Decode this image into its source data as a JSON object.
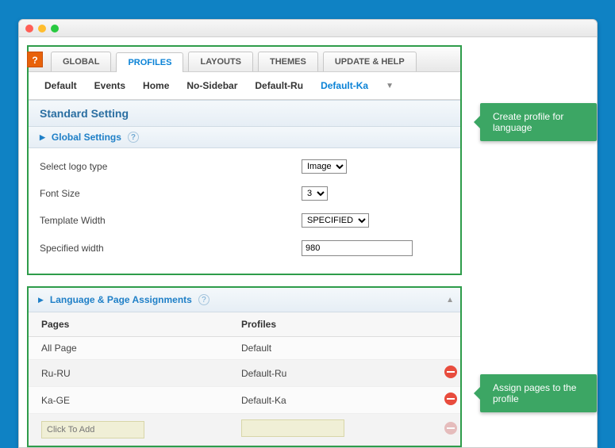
{
  "tabs": {
    "global": "GLOBAL",
    "profiles": "PROFILES",
    "layouts": "LAYOUTS",
    "themes": "THEMES",
    "update": "UPDATE & HELP"
  },
  "profileTabs": {
    "default": "Default",
    "events": "Events",
    "home": "Home",
    "nosidebar": "No-Sidebar",
    "defaultru": "Default-Ru",
    "defaultka": "Default-Ka"
  },
  "section": {
    "standard": "Standard Setting",
    "globalSettings": "Global Settings"
  },
  "form": {
    "logoLabel": "Select logo type",
    "logoValue": "Image",
    "fontLabel": "Font Size",
    "fontValue": "3",
    "widthLabel": "Template Width",
    "widthValue": "SPECIFIED",
    "specWidthLabel": "Specified width",
    "specWidthValue": "980"
  },
  "assign": {
    "header": "Language & Page Assignments",
    "colPages": "Pages",
    "colProfiles": "Profiles",
    "rows": [
      {
        "page": "All Page",
        "profile": "Default"
      },
      {
        "page": "Ru-RU",
        "profile": "Default-Ru"
      },
      {
        "page": "Ka-GE",
        "profile": "Default-Ka"
      }
    ],
    "addPlaceholder": "Click To Add"
  },
  "callouts": {
    "create": "Create profile for language",
    "assign": "Assign pages to the profile"
  },
  "helpBadge": "?"
}
